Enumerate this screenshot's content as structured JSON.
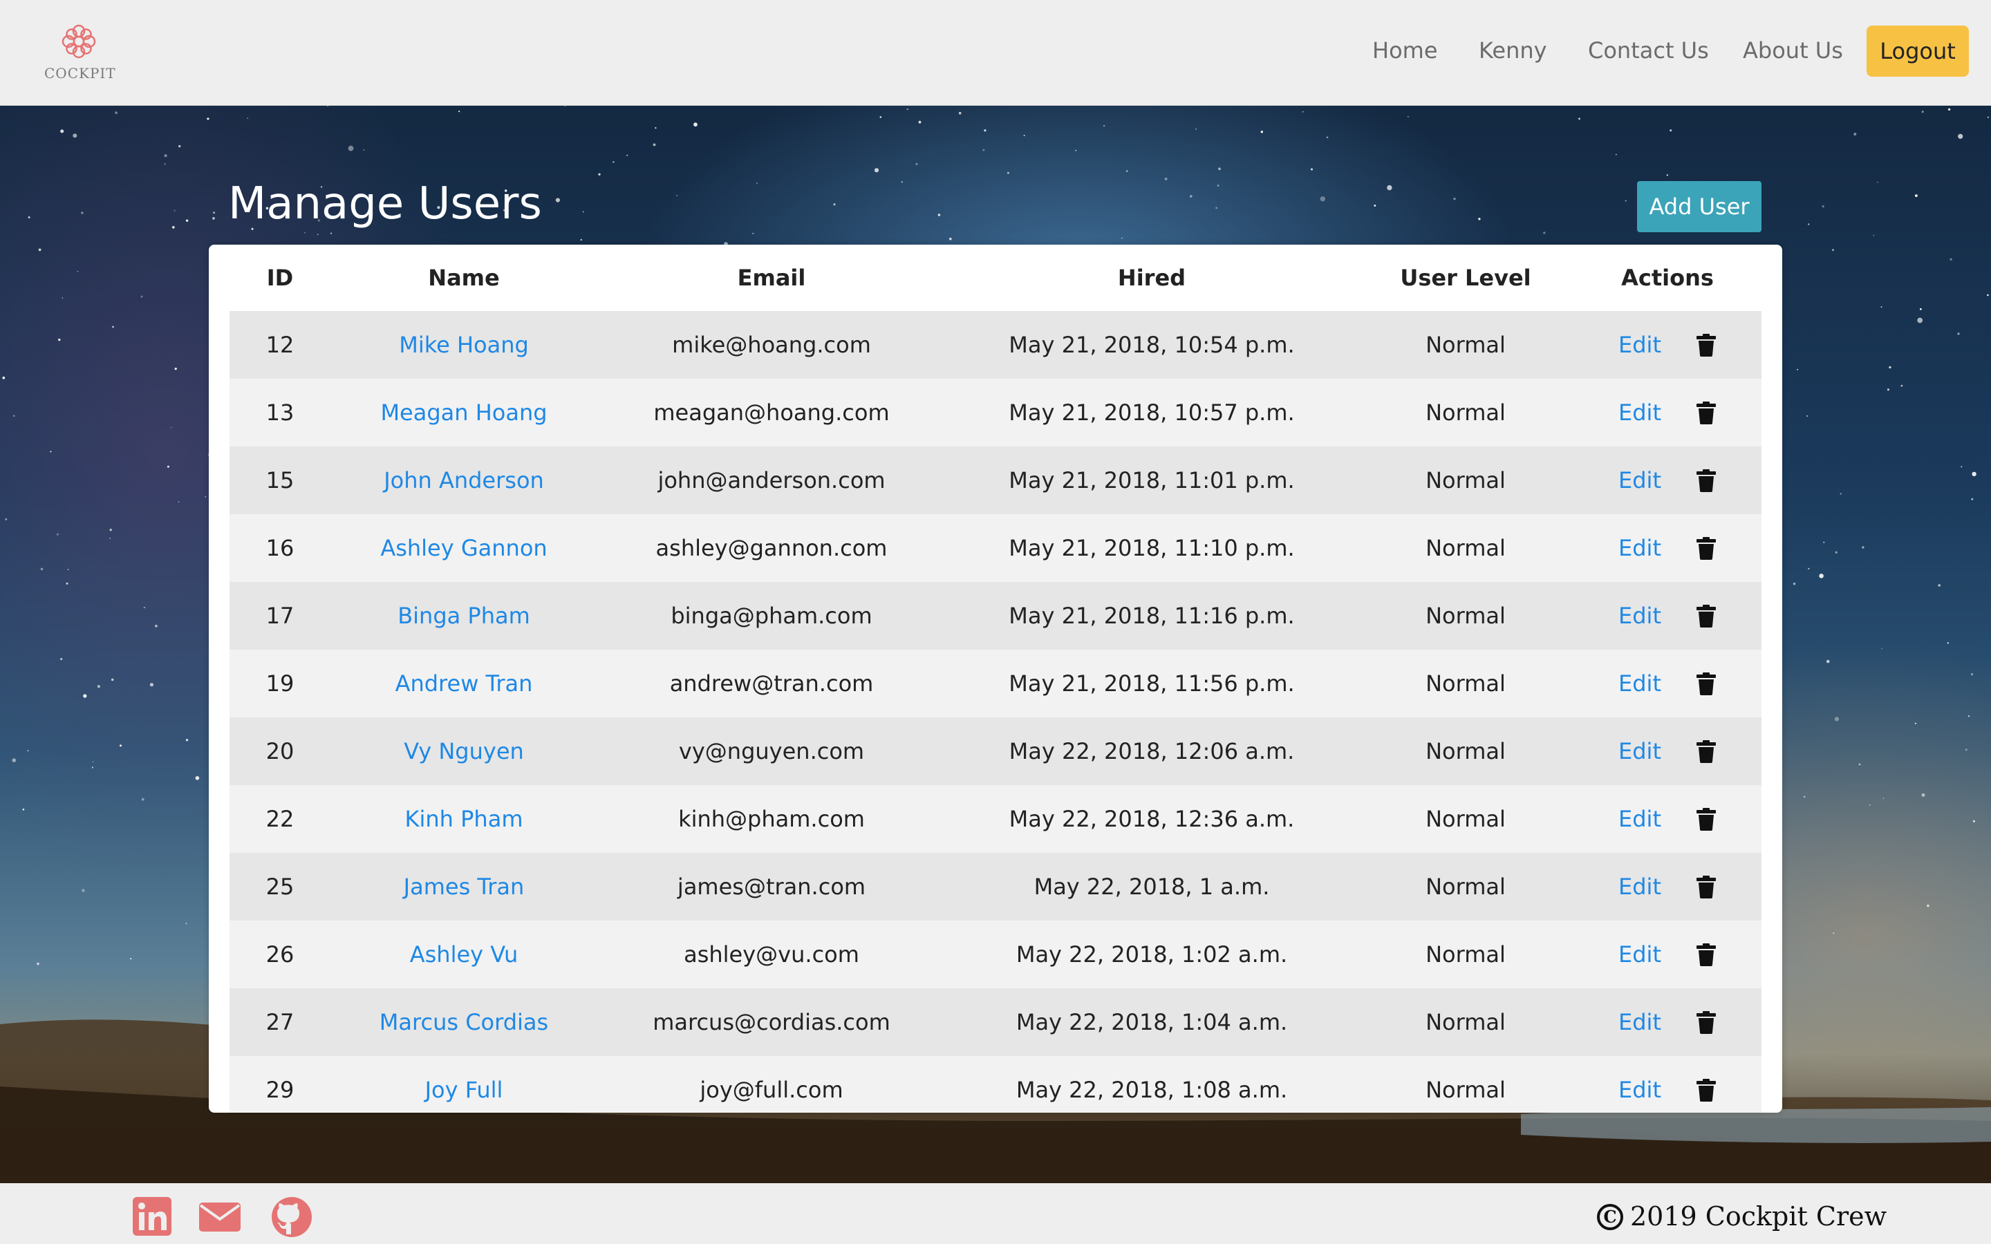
{
  "brand": {
    "logo_text": "COCKPIT",
    "accent": "#e57373"
  },
  "nav": {
    "items": [
      "Home",
      "Kenny",
      "Contact Us",
      "About Us"
    ],
    "logout_label": "Logout"
  },
  "page": {
    "title": "Manage Users",
    "add_user_label": "Add User"
  },
  "table": {
    "columns": [
      "ID",
      "Name",
      "Email",
      "Hired",
      "User Level",
      "Actions"
    ],
    "edit_label": "Edit",
    "rows": [
      {
        "id": "12",
        "name": "Mike Hoang",
        "email": "mike@hoang.com",
        "hired": "May 21, 2018, 10:54 p.m.",
        "level": "Normal"
      },
      {
        "id": "13",
        "name": "Meagan Hoang",
        "email": "meagan@hoang.com",
        "hired": "May 21, 2018, 10:57 p.m.",
        "level": "Normal"
      },
      {
        "id": "15",
        "name": "John Anderson",
        "email": "john@anderson.com",
        "hired": "May 21, 2018, 11:01 p.m.",
        "level": "Normal"
      },
      {
        "id": "16",
        "name": "Ashley Gannon",
        "email": "ashley@gannon.com",
        "hired": "May 21, 2018, 11:10 p.m.",
        "level": "Normal"
      },
      {
        "id": "17",
        "name": "Binga Pham",
        "email": "binga@pham.com",
        "hired": "May 21, 2018, 11:16 p.m.",
        "level": "Normal"
      },
      {
        "id": "19",
        "name": "Andrew Tran",
        "email": "andrew@tran.com",
        "hired": "May 21, 2018, 11:56 p.m.",
        "level": "Normal"
      },
      {
        "id": "20",
        "name": "Vy Nguyen",
        "email": "vy@nguyen.com",
        "hired": "May 22, 2018, 12:06 a.m.",
        "level": "Normal"
      },
      {
        "id": "22",
        "name": "Kinh Pham",
        "email": "kinh@pham.com",
        "hired": "May 22, 2018, 12:36 a.m.",
        "level": "Normal"
      },
      {
        "id": "25",
        "name": "James Tran",
        "email": "james@tran.com",
        "hired": "May 22, 2018, 1 a.m.",
        "level": "Normal"
      },
      {
        "id": "26",
        "name": "Ashley Vu",
        "email": "ashley@vu.com",
        "hired": "May 22, 2018, 1:02 a.m.",
        "level": "Normal"
      },
      {
        "id": "27",
        "name": "Marcus Cordias",
        "email": "marcus@cordias.com",
        "hired": "May 22, 2018, 1:04 a.m.",
        "level": "Normal"
      },
      {
        "id": "29",
        "name": "Joy Full",
        "email": "joy@full.com",
        "hired": "May 22, 2018, 1:08 a.m.",
        "level": "Normal"
      }
    ]
  },
  "footer": {
    "social_icons": [
      "linkedin-icon",
      "mail-icon",
      "github-icon"
    ],
    "copyright": "2019 Cockpit Crew"
  },
  "colors": {
    "link": "#1e88e5",
    "logout_button": "#f7c244",
    "add_user_button": "#3ba4b8",
    "social": "#e57373"
  }
}
